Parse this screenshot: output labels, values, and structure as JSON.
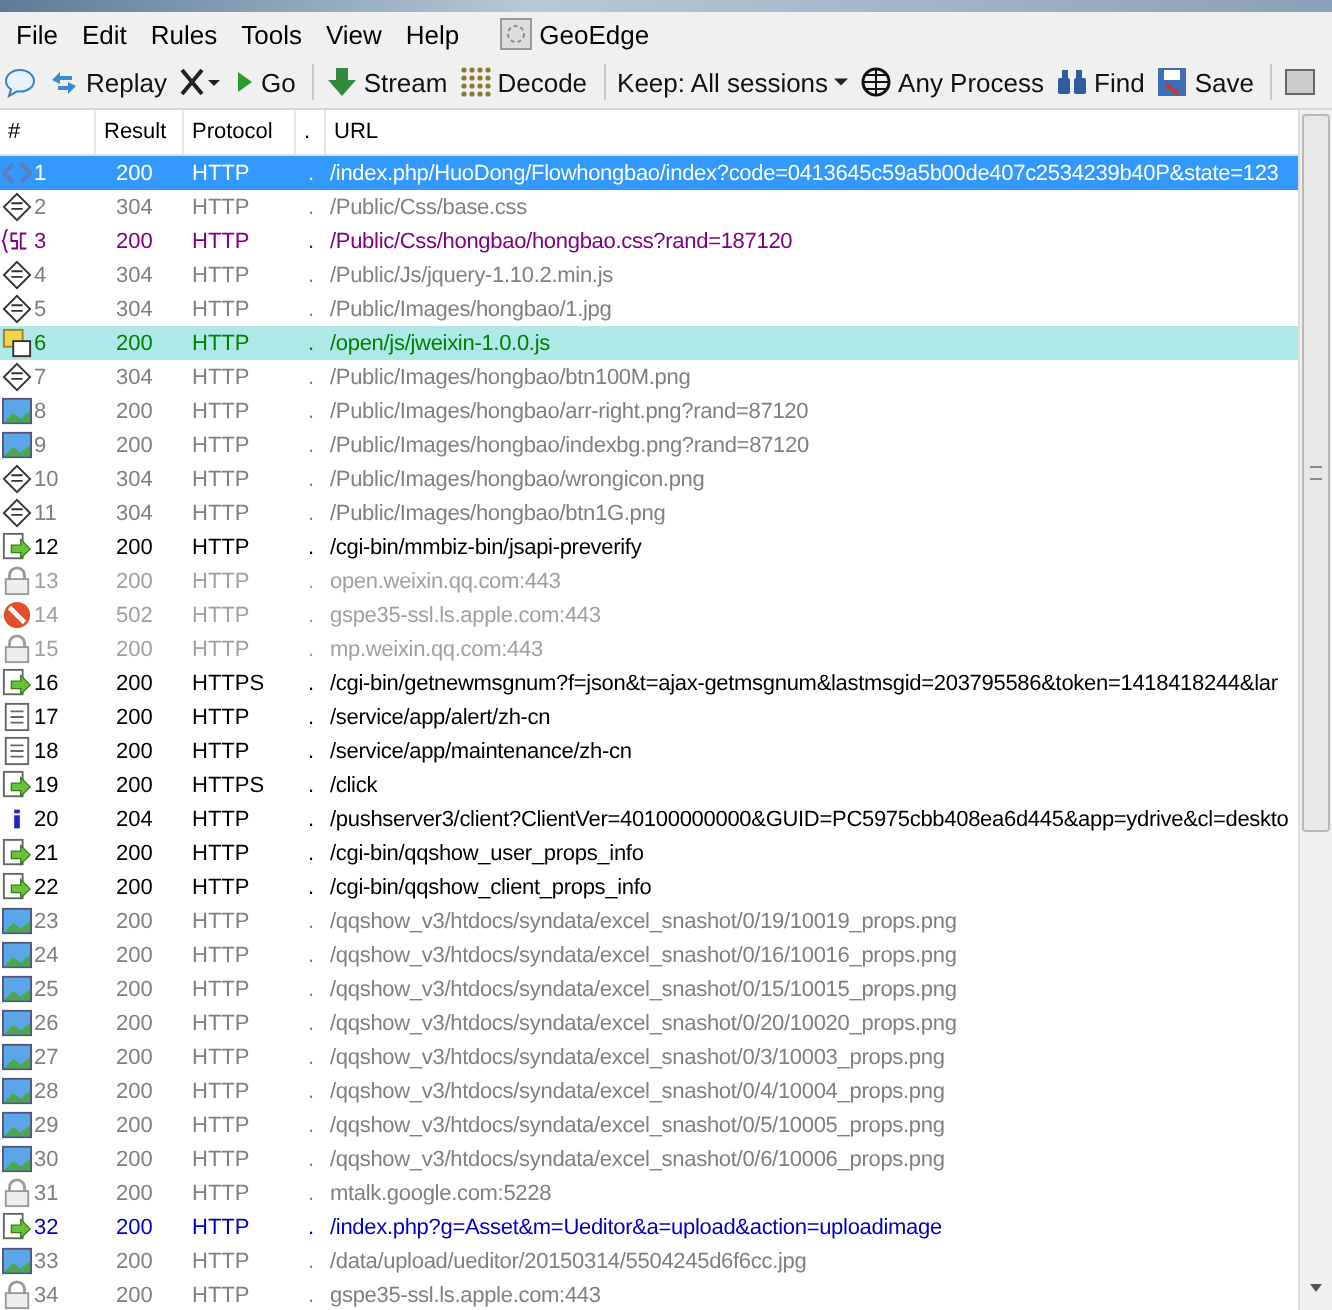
{
  "menu": [
    {
      "label": "File"
    },
    {
      "label": "Edit"
    },
    {
      "label": "Rules"
    },
    {
      "label": "Tools"
    },
    {
      "label": "View"
    },
    {
      "label": "Help"
    },
    {
      "label": "GeoEdge",
      "kind": "geoedge"
    }
  ],
  "toolbar": [
    {
      "kind": "comment"
    },
    {
      "kind": "replay",
      "label": "Replay"
    },
    {
      "kind": "remove"
    },
    {
      "kind": "go",
      "label": "Go"
    },
    {
      "kind": "sep"
    },
    {
      "kind": "stream",
      "label": "Stream"
    },
    {
      "kind": "decode",
      "label": "Decode"
    },
    {
      "kind": "sep"
    },
    {
      "kind": "keep",
      "label": "Keep: All sessions"
    },
    {
      "kind": "process",
      "label": "Any Process"
    },
    {
      "kind": "find",
      "label": "Find"
    },
    {
      "kind": "save",
      "label": "Save"
    },
    {
      "kind": "sep"
    },
    {
      "kind": "more"
    }
  ],
  "columns": [
    "#",
    "Result",
    "Protocol",
    ".",
    "URL"
  ],
  "rows": [
    {
      "kind": "script",
      "num": "1",
      "result": "200",
      "protocol": "HTTP",
      "host": ".",
      "url": "/index.php/HuoDong/Flowhongbao/index?code=0413645c59a5b00de407c2534239b40P&state=123",
      "color": "#ffffff",
      "selected": true,
      "marked": false
    },
    {
      "kind": "cached",
      "num": "2",
      "result": "304",
      "protocol": "HTTP",
      "host": ".",
      "url": "/Public/Css/base.css",
      "color": "#808080",
      "selected": false,
      "marked": false
    },
    {
      "kind": "css",
      "num": "3",
      "result": "200",
      "protocol": "HTTP",
      "host": ".",
      "url": "/Public/Css/hongbao/hongbao.css?rand=187120",
      "color": "#800080",
      "selected": false,
      "marked": false
    },
    {
      "kind": "cached",
      "num": "4",
      "result": "304",
      "protocol": "HTTP",
      "host": ".",
      "url": "/Public/Js/jquery-1.10.2.min.js",
      "color": "#808080",
      "selected": false,
      "marked": false
    },
    {
      "kind": "cached",
      "num": "5",
      "result": "304",
      "protocol": "HTTP",
      "host": ".",
      "url": "/Public/Images/hongbao/1.jpg",
      "color": "#808080",
      "selected": false,
      "marked": false
    },
    {
      "kind": "js",
      "num": "6",
      "result": "200",
      "protocol": "HTTP",
      "host": ".",
      "url": "/open/js/jweixin-1.0.0.js",
      "color": "#008000",
      "selected": false,
      "marked": true
    },
    {
      "kind": "cached",
      "num": "7",
      "result": "304",
      "protocol": "HTTP",
      "host": ".",
      "url": "/Public/Images/hongbao/btn100M.png",
      "color": "#808080",
      "selected": false,
      "marked": false
    },
    {
      "kind": "image",
      "num": "8",
      "result": "200",
      "protocol": "HTTP",
      "host": ".",
      "url": "/Public/Images/hongbao/arr-right.png?rand=87120",
      "color": "#808080",
      "selected": false,
      "marked": false
    },
    {
      "kind": "image",
      "num": "9",
      "result": "200",
      "protocol": "HTTP",
      "host": ".",
      "url": "/Public/Images/hongbao/indexbg.png?rand=87120",
      "color": "#808080",
      "selected": false,
      "marked": false
    },
    {
      "kind": "cached",
      "num": "10",
      "result": "304",
      "protocol": "HTTP",
      "host": ".",
      "url": "/Public/Images/hongbao/wrongicon.png",
      "color": "#808080",
      "selected": false,
      "marked": false
    },
    {
      "kind": "cached",
      "num": "11",
      "result": "304",
      "protocol": "HTTP",
      "host": ".",
      "url": "/Public/Images/hongbao/btn1G.png",
      "color": "#808080",
      "selected": false,
      "marked": false
    },
    {
      "kind": "response",
      "num": "12",
      "result": "200",
      "protocol": "HTTP",
      "host": ".",
      "url": "/cgi-bin/mmbiz-bin/jsapi-preverify",
      "color": "#000000",
      "selected": false,
      "marked": false
    },
    {
      "kind": "tunnel",
      "num": "13",
      "result": "200",
      "protocol": "HTTP",
      "host": ".",
      "url": "open.weixin.qq.com:443",
      "color": "#a0a0a0",
      "selected": false,
      "marked": false
    },
    {
      "kind": "blocked",
      "num": "14",
      "result": "502",
      "protocol": "HTTP",
      "host": ".",
      "url": "gspe35-ssl.ls.apple.com:443",
      "color": "#a0a0a0",
      "selected": false,
      "marked": false
    },
    {
      "kind": "tunnel",
      "num": "15",
      "result": "200",
      "protocol": "HTTP",
      "host": ".",
      "url": "mp.weixin.qq.com:443",
      "color": "#a0a0a0",
      "selected": false,
      "marked": false
    },
    {
      "kind": "response",
      "num": "16",
      "result": "200",
      "protocol": "HTTPS",
      "host": ".",
      "url": "/cgi-bin/getnewmsgnum?f=json&t=ajax-getmsgnum&lastmsgid=203795586&token=1418418244&lar",
      "color": "#000000",
      "selected": false,
      "marked": false
    },
    {
      "kind": "document",
      "num": "17",
      "result": "200",
      "protocol": "HTTP",
      "host": ".",
      "url": "/service/app/alert/zh-cn",
      "color": "#000000",
      "selected": false,
      "marked": false
    },
    {
      "kind": "document",
      "num": "18",
      "result": "200",
      "protocol": "HTTP",
      "host": ".",
      "url": "/service/app/maintenance/zh-cn",
      "color": "#000000",
      "selected": false,
      "marked": false
    },
    {
      "kind": "response",
      "num": "19",
      "result": "200",
      "protocol": "HTTPS",
      "host": ".",
      "url": "/click",
      "color": "#000000",
      "selected": false,
      "marked": false
    },
    {
      "kind": "info",
      "num": "20",
      "result": "204",
      "protocol": "HTTP",
      "host": ".",
      "url": "/pushserver3/client?ClientVer=40100000000&GUID=PC5975cbb408ea6d445&app=ydrive&cl=deskto",
      "color": "#000000",
      "selected": false,
      "marked": false
    },
    {
      "kind": "response",
      "num": "21",
      "result": "200",
      "protocol": "HTTP",
      "host": ".",
      "url": "/cgi-bin/qqshow_user_props_info",
      "color": "#000000",
      "selected": false,
      "marked": false
    },
    {
      "kind": "response",
      "num": "22",
      "result": "200",
      "protocol": "HTTP",
      "host": ".",
      "url": "/cgi-bin/qqshow_client_props_info",
      "color": "#000000",
      "selected": false,
      "marked": false
    },
    {
      "kind": "image",
      "num": "23",
      "result": "200",
      "protocol": "HTTP",
      "host": ".",
      "url": "/qqshow_v3/htdocs/syndata/excel_snashot/0/19/10019_props.png",
      "color": "#808080",
      "selected": false,
      "marked": false
    },
    {
      "kind": "image",
      "num": "24",
      "result": "200",
      "protocol": "HTTP",
      "host": ".",
      "url": "/qqshow_v3/htdocs/syndata/excel_snashot/0/16/10016_props.png",
      "color": "#808080",
      "selected": false,
      "marked": false
    },
    {
      "kind": "image",
      "num": "25",
      "result": "200",
      "protocol": "HTTP",
      "host": ".",
      "url": "/qqshow_v3/htdocs/syndata/excel_snashot/0/15/10015_props.png",
      "color": "#808080",
      "selected": false,
      "marked": false
    },
    {
      "kind": "image",
      "num": "26",
      "result": "200",
      "protocol": "HTTP",
      "host": ".",
      "url": "/qqshow_v3/htdocs/syndata/excel_snashot/0/20/10020_props.png",
      "color": "#808080",
      "selected": false,
      "marked": false
    },
    {
      "kind": "image",
      "num": "27",
      "result": "200",
      "protocol": "HTTP",
      "host": ".",
      "url": "/qqshow_v3/htdocs/syndata/excel_snashot/0/3/10003_props.png",
      "color": "#808080",
      "selected": false,
      "marked": false
    },
    {
      "kind": "image",
      "num": "28",
      "result": "200",
      "protocol": "HTTP",
      "host": ".",
      "url": "/qqshow_v3/htdocs/syndata/excel_snashot/0/4/10004_props.png",
      "color": "#808080",
      "selected": false,
      "marked": false
    },
    {
      "kind": "image",
      "num": "29",
      "result": "200",
      "protocol": "HTTP",
      "host": ".",
      "url": "/qqshow_v3/htdocs/syndata/excel_snashot/0/5/10005_props.png",
      "color": "#808080",
      "selected": false,
      "marked": false
    },
    {
      "kind": "image",
      "num": "30",
      "result": "200",
      "protocol": "HTTP",
      "host": ".",
      "url": "/qqshow_v3/htdocs/syndata/excel_snashot/0/6/10006_props.png",
      "color": "#808080",
      "selected": false,
      "marked": false
    },
    {
      "kind": "tunnel",
      "num": "31",
      "result": "200",
      "protocol": "HTTP",
      "host": ".",
      "url": "mtalk.google.com:5228",
      "color": "#808080",
      "selected": false,
      "marked": false
    },
    {
      "kind": "response",
      "num": "32",
      "result": "200",
      "protocol": "HTTP",
      "host": ".",
      "url": "/index.php?g=Asset&m=Ueditor&a=upload&action=uploadimage",
      "color": "#0000c0",
      "selected": false,
      "marked": false
    },
    {
      "kind": "image",
      "num": "33",
      "result": "200",
      "protocol": "HTTP",
      "host": ".",
      "url": "/data/upload/ueditor/20150314/5504245d6f6cc.jpg",
      "color": "#808080",
      "selected": false,
      "marked": false
    },
    {
      "kind": "tunnel",
      "num": "34",
      "result": "200",
      "protocol": "HTTP",
      "host": ".",
      "url": "gspe35-ssl.ls.apple.com:443",
      "color": "#808080",
      "selected": false,
      "marked": false
    }
  ]
}
